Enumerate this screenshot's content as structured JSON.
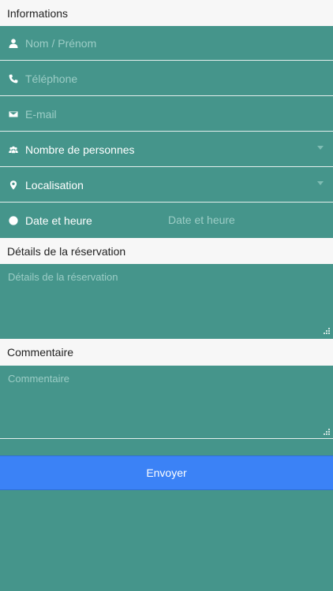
{
  "sections": {
    "informations": "Informations",
    "details": "Détails de la réservation",
    "commentaire": "Commentaire"
  },
  "fields": {
    "name": {
      "icon": "user-icon",
      "placeholder": "Nom / Prénom"
    },
    "phone": {
      "icon": "phone-icon",
      "placeholder": "Téléphone"
    },
    "email": {
      "icon": "mail-icon",
      "placeholder": "E-mail"
    },
    "persons": {
      "icon": "group-icon",
      "value": "Nombre de personnes"
    },
    "location": {
      "icon": "location-pin-icon",
      "value": "Localisation"
    },
    "datetime": {
      "icon": "clock-icon",
      "label": "Date et heure",
      "placeholder": "Date et heure"
    }
  },
  "textareas": {
    "details": {
      "placeholder": "Détails de la réservation"
    },
    "commentaire": {
      "placeholder": "Commentaire"
    }
  },
  "submit": {
    "label": "Envoyer"
  },
  "colors": {
    "background": "#45958b",
    "header_bg": "#f7f7f7",
    "button": "#3b82f6",
    "placeholder": "#9ccdc6"
  }
}
